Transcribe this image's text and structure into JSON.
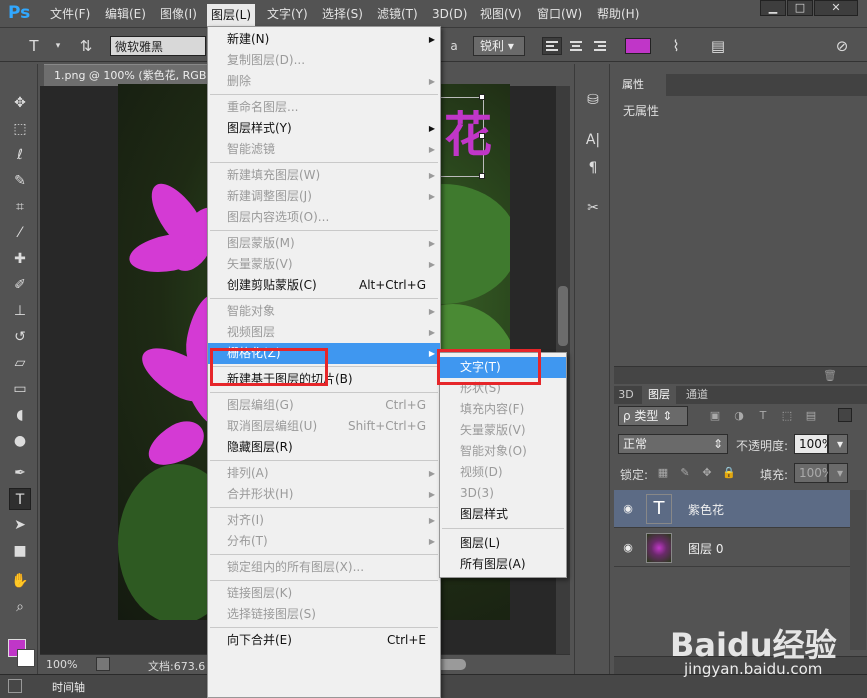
{
  "app": {
    "logo": "Ps"
  },
  "menubar": {
    "items": [
      "文件(F)",
      "编辑(E)",
      "图像(I)",
      "图层(L)",
      "文字(Y)",
      "选择(S)",
      "滤镜(T)",
      "3D(D)",
      "视图(V)",
      "窗口(W)",
      "帮助(H)"
    ],
    "active_index": 3
  },
  "window_controls": {
    "minimize": "▁",
    "restore": "□",
    "close": "✕"
  },
  "options_bar": {
    "font_family": "微软雅黑",
    "anti_alias": "锐利",
    "text_color": "#c036c8",
    "aa_icon": "a"
  },
  "document": {
    "tab_title": "1.png @ 100% (紫色花, RGB",
    "zoom": "100%",
    "doc_info": "文档:673.6",
    "text_layer_glyph": "花"
  },
  "timeline": {
    "label": "时间轴"
  },
  "properties": {
    "tab": "属性",
    "empty": "无属性"
  },
  "layers_panel": {
    "tabs": [
      "3D",
      "图层",
      "通道"
    ],
    "active_tab": 1,
    "filter_kind": "ρ 类型",
    "blend_mode": "正常",
    "opacity_label": "不透明度:",
    "opacity_value": "100%",
    "lock_label": "锁定:",
    "fill_label": "填充:",
    "fill_value": "100%",
    "layers": [
      {
        "name": "紫色花",
        "type": "text",
        "thumb_glyph": "T",
        "selected": true
      },
      {
        "name": "图层 0",
        "type": "image",
        "selected": false
      }
    ]
  },
  "layer_menu": {
    "items": [
      {
        "label": "新建(N)",
        "submenu": true
      },
      {
        "label": "复制图层(D)...",
        "disabled": true
      },
      {
        "label": "删除",
        "disabled": true,
        "submenu": true
      },
      {
        "sep": true
      },
      {
        "label": "重命名图层...",
        "disabled": true
      },
      {
        "label": "图层样式(Y)",
        "submenu": true
      },
      {
        "label": "智能滤镜",
        "disabled": true,
        "submenu": true
      },
      {
        "sep": true
      },
      {
        "label": "新建填充图层(W)",
        "disabled": true,
        "submenu": true
      },
      {
        "label": "新建调整图层(J)",
        "disabled": true,
        "submenu": true
      },
      {
        "label": "图层内容选项(O)...",
        "disabled": true
      },
      {
        "sep": true
      },
      {
        "label": "图层蒙版(M)",
        "disabled": true,
        "submenu": true
      },
      {
        "label": "矢量蒙版(V)",
        "disabled": true,
        "submenu": true
      },
      {
        "label": "创建剪贴蒙版(C)",
        "shortcut": "Alt+Ctrl+G"
      },
      {
        "sep": true
      },
      {
        "label": "智能对象",
        "disabled": true,
        "submenu": true
      },
      {
        "label": "视频图层",
        "disabled": true,
        "submenu": true
      },
      {
        "label": "栅格化(Z)",
        "submenu": true,
        "highlighted": true
      },
      {
        "sep": true
      },
      {
        "label": "新建基于图层的切片(B)"
      },
      {
        "sep": true
      },
      {
        "label": "图层编组(G)",
        "disabled": true,
        "shortcut": "Ctrl+G"
      },
      {
        "label": "取消图层编组(U)",
        "disabled": true,
        "shortcut": "Shift+Ctrl+G"
      },
      {
        "label": "隐藏图层(R)"
      },
      {
        "sep": true
      },
      {
        "label": "排列(A)",
        "disabled": true,
        "submenu": true
      },
      {
        "label": "合并形状(H)",
        "disabled": true,
        "submenu": true
      },
      {
        "sep": true
      },
      {
        "label": "对齐(I)",
        "disabled": true,
        "submenu": true
      },
      {
        "label": "分布(T)",
        "disabled": true,
        "submenu": true
      },
      {
        "sep": true
      },
      {
        "label": "锁定组内的所有图层(X)...",
        "disabled": true
      },
      {
        "sep": true
      },
      {
        "label": "链接图层(K)",
        "disabled": true
      },
      {
        "label": "选择链接图层(S)",
        "disabled": true
      },
      {
        "sep": true
      },
      {
        "label": "向下合并(E)",
        "shortcut": "Ctrl+E"
      }
    ]
  },
  "rasterize_submenu": {
    "items": [
      {
        "label": "文字(T)",
        "highlighted": true
      },
      {
        "label": "形状(S)",
        "disabled": true
      },
      {
        "label": "填充内容(F)",
        "disabled": true
      },
      {
        "label": "矢量蒙版(V)",
        "disabled": true
      },
      {
        "label": "智能对象(O)",
        "disabled": true
      },
      {
        "label": "视频(D)",
        "disabled": true
      },
      {
        "label": "3D(3)",
        "disabled": true
      },
      {
        "label": "图层样式"
      },
      {
        "sep": true
      },
      {
        "label": "图层(L)"
      },
      {
        "label": "所有图层(A)"
      }
    ]
  },
  "watermark": {
    "logo": "Baidu经验",
    "url": "jingyan.baidu.com"
  }
}
